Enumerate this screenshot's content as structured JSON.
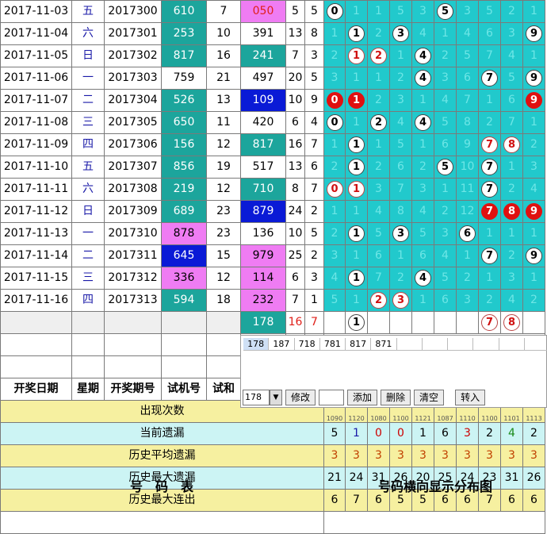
{
  "rows": [
    {
      "date": "2017-11-03",
      "week": "五",
      "period": "2017300",
      "trial": "610",
      "sum": "7",
      "num": "050",
      "span": "5",
      "k": "5",
      "dist": [
        [
          "ball-w",
          "0"
        ],
        "1",
        "1",
        "5",
        "3",
        [
          "ball-w",
          "5"
        ],
        "3",
        "5",
        "2",
        "1"
      ],
      "t": "teal",
      "n": "pink"
    },
    {
      "date": "2017-11-04",
      "week": "六",
      "period": "2017301",
      "trial": "253",
      "sum": "10",
      "num": "391",
      "span": "13",
      "k": "8",
      "dist": [
        "1",
        [
          "ball-w",
          "1"
        ],
        "2",
        [
          "ball-w",
          "3"
        ],
        "4",
        "1",
        "4",
        "6",
        "3",
        [
          "ball-w",
          "9"
        ]
      ],
      "t": "teal",
      "n": ""
    },
    {
      "date": "2017-11-05",
      "week": "日",
      "period": "2017302",
      "trial": "817",
      "sum": "16",
      "num": "241",
      "span": "7",
      "k": "3",
      "dist": [
        "2",
        [
          "ball-o",
          "1"
        ],
        [
          "ball-o",
          "2"
        ],
        "1",
        [
          "ball-w",
          "4"
        ],
        "2",
        "5",
        "7",
        "4",
        "1"
      ],
      "t": "teal",
      "n": "teal"
    },
    {
      "date": "2017-11-06",
      "week": "一",
      "period": "2017303",
      "trial": "759",
      "sum": "21",
      "num": "497",
      "span": "20",
      "k": "5",
      "dist": [
        "3",
        "1",
        "1",
        "2",
        [
          "ball-w",
          "4"
        ],
        "3",
        "6",
        [
          "ball-w",
          "7"
        ],
        "5",
        [
          "ball-w",
          "9"
        ]
      ],
      "t": "",
      "n": ""
    },
    {
      "date": "2017-11-07",
      "week": "二",
      "period": "2017304",
      "trial": "526",
      "sum": "13",
      "num": "109",
      "span": "10",
      "k": "9",
      "dist": [
        [
          "ball-r",
          "0"
        ],
        [
          "ball-r",
          "1"
        ],
        "2",
        "3",
        "1",
        "4",
        "7",
        "1",
        "6",
        [
          "ball-r",
          "9"
        ]
      ],
      "t": "teal",
      "n": "blue"
    },
    {
      "date": "2017-11-08",
      "week": "三",
      "period": "2017305",
      "trial": "650",
      "sum": "11",
      "num": "420",
      "span": "6",
      "k": "4",
      "dist": [
        [
          "ball-w",
          "0"
        ],
        "1",
        [
          "ball-w",
          "2"
        ],
        "4",
        [
          "ball-w",
          "4"
        ],
        "5",
        "8",
        "2",
        "7",
        "1"
      ],
      "t": "teal",
      "n": ""
    },
    {
      "date": "2017-11-09",
      "week": "四",
      "period": "2017306",
      "trial": "156",
      "sum": "12",
      "num": "817",
      "span": "16",
      "k": "7",
      "dist": [
        "1",
        [
          "ball-w",
          "1"
        ],
        "1",
        "5",
        "1",
        "6",
        "9",
        [
          "ball-o",
          "7"
        ],
        [
          "ball-o",
          "8"
        ],
        "2"
      ],
      "t": "teal",
      "n": "teal"
    },
    {
      "date": "2017-11-10",
      "week": "五",
      "period": "2017307",
      "trial": "856",
      "sum": "19",
      "num": "517",
      "span": "13",
      "k": "6",
      "dist": [
        "2",
        [
          "ball-w",
          "1"
        ],
        "2",
        "6",
        "2",
        [
          "ball-w",
          "5"
        ],
        "10",
        [
          "ball-w",
          "7"
        ],
        "1",
        "3"
      ],
      "t": "teal",
      "n": ""
    },
    {
      "date": "2017-11-11",
      "week": "六",
      "period": "2017308",
      "trial": "219",
      "sum": "12",
      "num": "710",
      "span": "8",
      "k": "7",
      "dist": [
        [
          "ball-o",
          "0"
        ],
        [
          "ball-o",
          "1"
        ],
        "3",
        "7",
        "3",
        "1",
        "11",
        [
          "ball-w",
          "7"
        ],
        "2",
        "4"
      ],
      "t": "teal",
      "n": "teal"
    },
    {
      "date": "2017-11-12",
      "week": "日",
      "period": "2017309",
      "trial": "689",
      "sum": "23",
      "num": "879",
      "span": "24",
      "k": "2",
      "dist": [
        "1",
        "1",
        "4",
        "8",
        "4",
        "2",
        "12",
        [
          "ball-r",
          "7"
        ],
        [
          "ball-r",
          "8"
        ],
        [
          "ball-r",
          "9"
        ]
      ],
      "t": "teal",
      "n": "blue"
    },
    {
      "date": "2017-11-13",
      "week": "一",
      "period": "2017310",
      "trial": "878",
      "sum": "23",
      "num": "136",
      "span": "10",
      "k": "5",
      "dist": [
        "2",
        [
          "ball-w",
          "1"
        ],
        "5",
        [
          "ball-w",
          "3"
        ],
        "5",
        "3",
        [
          "ball-w",
          "6"
        ],
        "1",
        "1",
        "1"
      ],
      "t": "pink",
      "n": ""
    },
    {
      "date": "2017-11-14",
      "week": "二",
      "period": "2017311",
      "trial": "645",
      "sum": "15",
      "num": "979",
      "span": "25",
      "k": "2",
      "dist": [
        "3",
        "1",
        "6",
        "1",
        "6",
        "4",
        "1",
        [
          "ball-w",
          "7"
        ],
        "2",
        [
          "ball-w",
          "9"
        ]
      ],
      "t": "blue",
      "n": "pink"
    },
    {
      "date": "2017-11-15",
      "week": "三",
      "period": "2017312",
      "trial": "336",
      "sum": "12",
      "num": "114",
      "span": "6",
      "k": "3",
      "dist": [
        "4",
        [
          "ball-w",
          "1"
        ],
        "7",
        "2",
        [
          "ball-w",
          "4"
        ],
        "5",
        "2",
        "1",
        "3",
        "1"
      ],
      "t": "pink",
      "n": "pink"
    },
    {
      "date": "2017-11-16",
      "week": "四",
      "period": "2017313",
      "trial": "594",
      "sum": "18",
      "num": "232",
      "span": "7",
      "k": "1",
      "dist": [
        "5",
        "1",
        [
          "ball-o",
          "2"
        ],
        [
          "ball-o",
          "3"
        ],
        "1",
        "6",
        "3",
        "2",
        "4",
        "2"
      ],
      "t": "teal",
      "n": "pink"
    }
  ],
  "predict": {
    "num": "178",
    "span": "16",
    "k": "7",
    "balls": [
      [
        "1",
        1
      ],
      [
        "7",
        7
      ],
      [
        "8",
        8
      ]
    ]
  },
  "panel": {
    "list": [
      "178",
      "187",
      "718",
      "781",
      "817",
      "871"
    ],
    "select": "178",
    "arrow": "▼",
    "modify": "修改",
    "add": "添加",
    "delete": "删除",
    "clear": "清空",
    "import": "转入"
  },
  "header": {
    "date": "开奖日期",
    "week": "星期",
    "period": "开奖期号",
    "trial": "试机号",
    "sum": "试和"
  },
  "stats": {
    "labels": [
      "出现次数",
      "当前遗漏",
      "历史平均遗漏",
      "历史最大遗漏",
      "历史最大连出"
    ],
    "first_row_partial": [
      "1090",
      "1120",
      "1080",
      "1100",
      "1121",
      "1087",
      "1110",
      "1100",
      "1101",
      "1113"
    ],
    "values": [
      [
        "5",
        "1",
        "0",
        "0",
        "1",
        "6",
        "3",
        "2",
        "4",
        "2"
      ],
      [
        "3",
        "3",
        "3",
        "3",
        "3",
        "3",
        "3",
        "3",
        "3",
        "3"
      ],
      [
        "21",
        "24",
        "31",
        "26",
        "20",
        "25",
        "24",
        "23",
        "31",
        "26"
      ],
      [
        "6",
        "7",
        "6",
        "5",
        "5",
        "6",
        "6",
        "7",
        "6",
        "6"
      ]
    ]
  },
  "footer": {
    "left": "号　码　表",
    "right": "号码横向显示分布图"
  }
}
